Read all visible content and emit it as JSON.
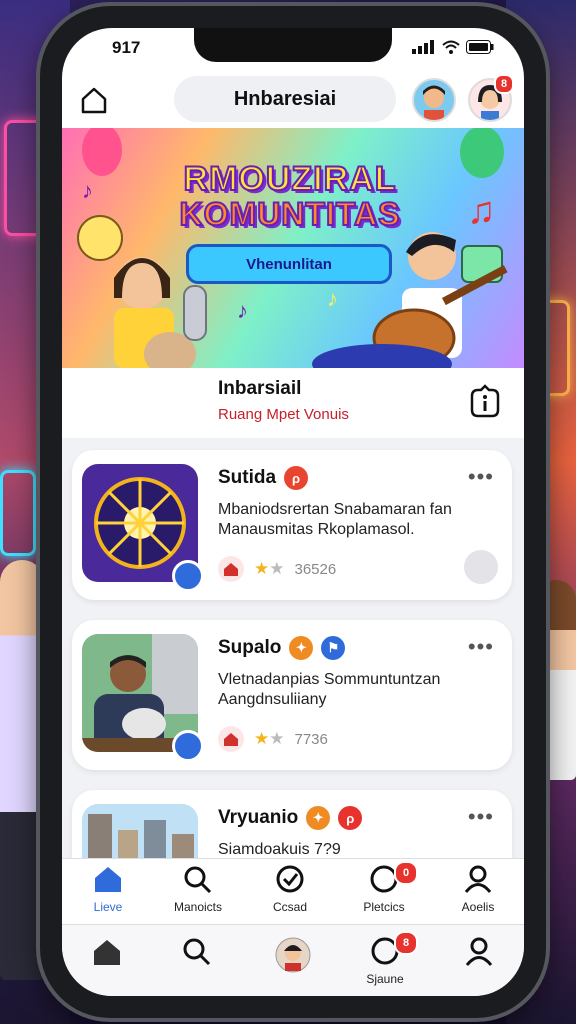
{
  "status": {
    "time": "917"
  },
  "header": {
    "title": "Hnbaresiai",
    "notification_count": "8"
  },
  "banner": {
    "title_line1": "RMOUZIRAL",
    "title_line2": "KOMUNTITAS",
    "ribbon": "Vhenunlitan"
  },
  "community": {
    "name": "Inbarsiail",
    "subtitle": "Ruang Mpet Vonuis"
  },
  "feed": {
    "cards": [
      {
        "title": "Sutida",
        "description": "Mbaniodsrertan Snabamaran fan Manausmitas Rkoplamasol.",
        "rating_count": "36526",
        "rating": 1
      },
      {
        "title": "Supalo",
        "description": "Vletnadanpias Sommuntuntzan Aangdnsuliiany",
        "rating_count": "7736",
        "rating": 1
      },
      {
        "title": "Vryuanio",
        "description": "Siamdoakuis 7?9",
        "rating_count": "",
        "rating": 0
      }
    ]
  },
  "tabs": [
    {
      "label": "Lieve",
      "icon": "home-icon"
    },
    {
      "label": "Manoicts",
      "icon": "search-icon"
    },
    {
      "label": "Ccsad",
      "icon": "check-circle-icon"
    },
    {
      "label": "Pletcics",
      "icon": "circle-icon",
      "badge": "0"
    },
    {
      "label": "Aoelis",
      "icon": "person-icon"
    }
  ],
  "nav": [
    {
      "label": "",
      "icon": "home-icon"
    },
    {
      "label": "",
      "icon": "search-icon"
    },
    {
      "label": "",
      "icon": "avatar"
    },
    {
      "label": "Sjaune",
      "icon": "circle-icon",
      "badge": "8"
    },
    {
      "label": "",
      "icon": "person-icon"
    }
  ],
  "colors": {
    "accent": "#2f6bdb",
    "badge": "#e8322e",
    "subtitle_red": "#c8202a",
    "star": "#f3b41b"
  }
}
